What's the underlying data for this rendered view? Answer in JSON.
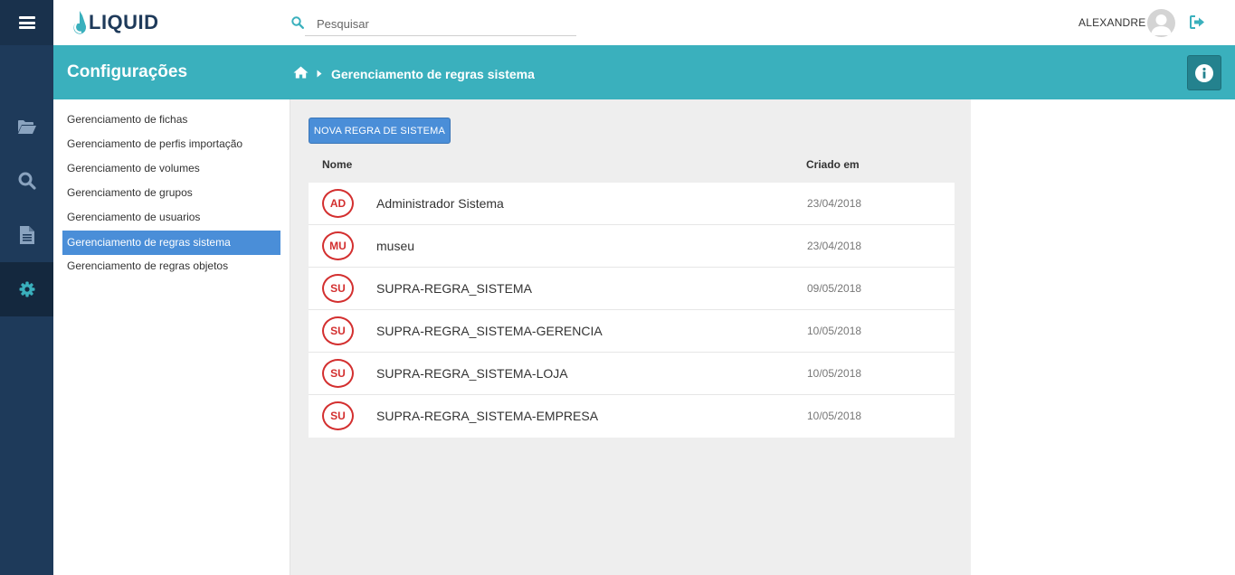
{
  "app": {
    "logo_text": "LIQUID",
    "user_name": "ALEXANDRE"
  },
  "search": {
    "placeholder": "Pesquisar"
  },
  "header": {
    "title": "Configurações",
    "breadcrumb_current": "Gerenciamento de regras sistema"
  },
  "rail": {
    "items": [
      {
        "icon": "folder-open-icon"
      },
      {
        "icon": "search-icon"
      },
      {
        "icon": "document-icon"
      },
      {
        "icon": "gear-icon",
        "active": true
      }
    ]
  },
  "settings_menu": {
    "items": [
      {
        "label": "Gerenciamento de fichas"
      },
      {
        "label": "Gerenciamento de perfis importação"
      },
      {
        "label": "Gerenciamento de volumes"
      },
      {
        "label": "Gerenciamento de grupos"
      },
      {
        "label": "Gerenciamento de usuarios"
      },
      {
        "label": "Gerenciamento de regras sistema",
        "active": true
      },
      {
        "label": "Gerenciamento de regras objetos"
      }
    ]
  },
  "main": {
    "new_button_label": "NOVA REGRA DE SISTEMA",
    "columns": {
      "name": "Nome",
      "created": "Criado em"
    },
    "rows": [
      {
        "initials": "AD",
        "name": "Administrador Sistema",
        "created": "23/04/2018"
      },
      {
        "initials": "MU",
        "name": "museu",
        "created": "23/04/2018"
      },
      {
        "initials": "SU",
        "name": "SUPRA-REGRA_SISTEMA",
        "created": "09/05/2018"
      },
      {
        "initials": "SU",
        "name": "SUPRA-REGRA_SISTEMA-GERENCIA",
        "created": "10/05/2018"
      },
      {
        "initials": "SU",
        "name": "SUPRA-REGRA_SISTEMA-LOJA",
        "created": "10/05/2018"
      },
      {
        "initials": "SU",
        "name": "SUPRA-REGRA_SISTEMA-EMPRESA",
        "created": "10/05/2018"
      }
    ]
  },
  "colors": {
    "rail": "#1e3a5a",
    "band": "#3ab0bd",
    "accent_blue": "#4a8ed8",
    "initials_red": "#d32f2f"
  }
}
